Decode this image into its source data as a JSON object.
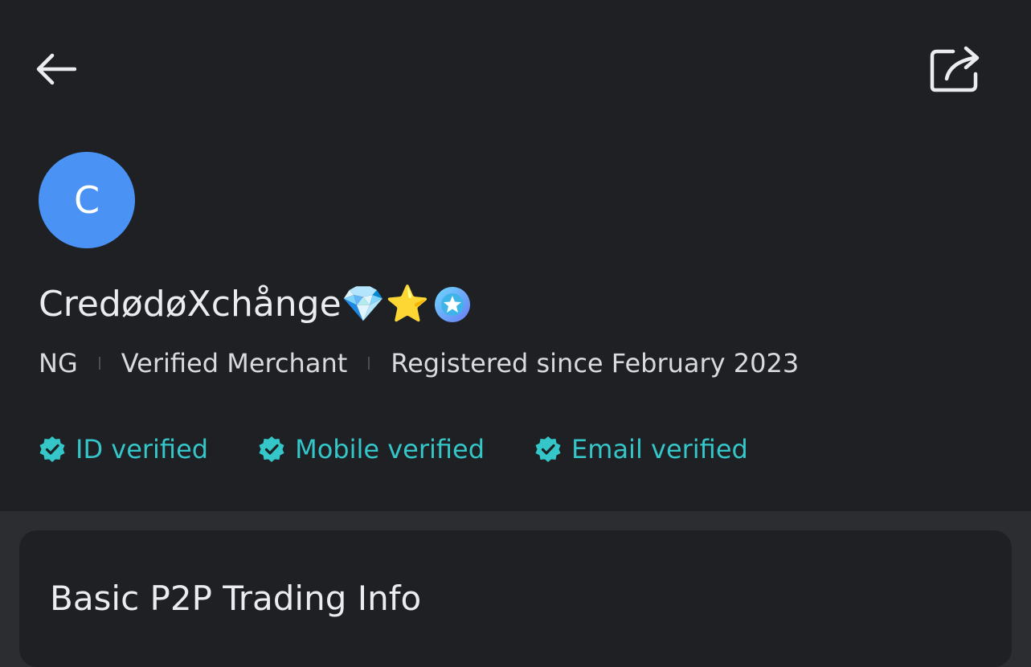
{
  "header": {
    "back_icon": "arrow-left-icon",
    "share_icon": "share-icon"
  },
  "profile": {
    "avatar_letter": "C",
    "avatar_color": "#4a93f5",
    "name": "CredødøXchånge💎⭐",
    "merchant_badge_icon": "merchant-star-badge-icon",
    "country": "NG",
    "status": "Verified Merchant",
    "registered": "Registered since February 2023"
  },
  "verifications": [
    {
      "label": "ID verified",
      "icon": "verified-check-icon"
    },
    {
      "label": "Mobile verified",
      "icon": "verified-check-icon"
    },
    {
      "label": "Email verified",
      "icon": "verified-check-icon"
    }
  ],
  "card": {
    "title": "Basic P2P Trading Info"
  },
  "colors": {
    "background": "#1e2024",
    "divider_band": "#2b2d31",
    "accent_teal": "#34c6c8",
    "text_primary": "#eaecef"
  }
}
